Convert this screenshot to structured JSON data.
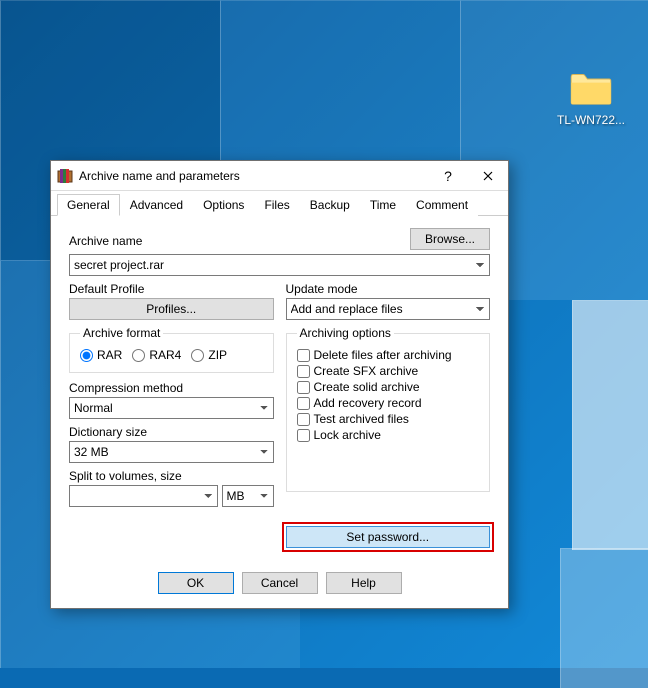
{
  "desktop": {
    "folder_name": "TL-WN722..."
  },
  "dialog": {
    "title": "Archive name and parameters",
    "tabs": [
      "General",
      "Advanced",
      "Options",
      "Files",
      "Backup",
      "Time",
      "Comment"
    ],
    "active_tab": 0,
    "archive_name_label": "Archive name",
    "archive_name_value": "secret project.rar",
    "browse_label": "Browse...",
    "default_profile_label": "Default Profile",
    "profiles_button": "Profiles...",
    "update_mode_label": "Update mode",
    "update_mode_value": "Add and replace files",
    "archive_format_label": "Archive format",
    "format_options": [
      "RAR",
      "RAR4",
      "ZIP"
    ],
    "format_selected": "RAR",
    "compression_label": "Compression method",
    "compression_value": "Normal",
    "dict_label": "Dictionary size",
    "dict_value": "32 MB",
    "split_label": "Split to volumes, size",
    "split_value": "",
    "split_unit": "MB",
    "archiving_options_label": "Archiving options",
    "archiving_options": [
      "Delete files after archiving",
      "Create SFX archive",
      "Create solid archive",
      "Add recovery record",
      "Test archived files",
      "Lock archive"
    ],
    "set_password_label": "Set password...",
    "ok_label": "OK",
    "cancel_label": "Cancel",
    "help_label": "Help"
  }
}
